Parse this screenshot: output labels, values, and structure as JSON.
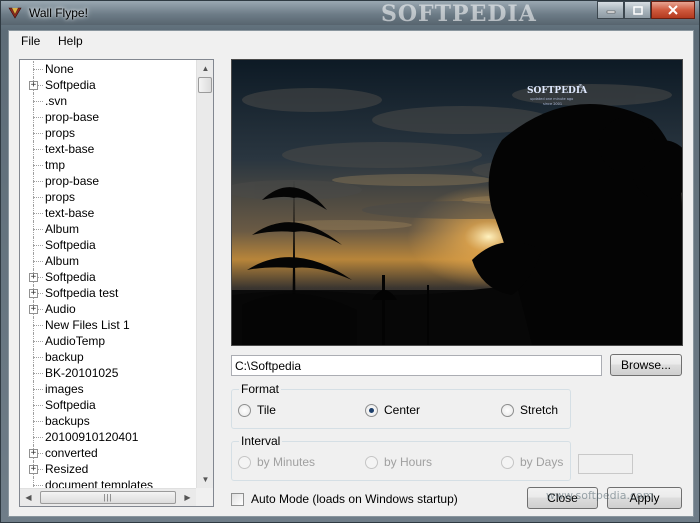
{
  "window": {
    "title": "Wall Flype!",
    "watermark": "SOFTPEDIA"
  },
  "menu": {
    "file": "File",
    "help": "Help"
  },
  "tree": {
    "items": [
      {
        "label": "None",
        "expandable": false
      },
      {
        "label": "Softpedia",
        "expandable": true
      },
      {
        "label": ".svn",
        "expandable": false
      },
      {
        "label": "prop-base",
        "expandable": false
      },
      {
        "label": "props",
        "expandable": false
      },
      {
        "label": "text-base",
        "expandable": false
      },
      {
        "label": "tmp",
        "expandable": false
      },
      {
        "label": "prop-base",
        "expandable": false
      },
      {
        "label": "props",
        "expandable": false
      },
      {
        "label": "text-base",
        "expandable": false
      },
      {
        "label": "Album",
        "expandable": false
      },
      {
        "label": "Softpedia",
        "expandable": false
      },
      {
        "label": "Album",
        "expandable": false
      },
      {
        "label": "Softpedia",
        "expandable": true
      },
      {
        "label": "Softpedia test",
        "expandable": true
      },
      {
        "label": "Audio",
        "expandable": true
      },
      {
        "label": "New Files List 1",
        "expandable": false
      },
      {
        "label": "AudioTemp",
        "expandable": false
      },
      {
        "label": "backup",
        "expandable": false
      },
      {
        "label": "BK-20101025",
        "expandable": false
      },
      {
        "label": "images",
        "expandable": false
      },
      {
        "label": "Softpedia",
        "expandable": false
      },
      {
        "label": "backups",
        "expandable": false
      },
      {
        "label": "20100910120401",
        "expandable": false
      },
      {
        "label": "converted",
        "expandable": true
      },
      {
        "label": "Resized",
        "expandable": true
      },
      {
        "label": "document templates",
        "expandable": false
      }
    ]
  },
  "preview": {
    "logo_text": "SOFTPEDIA",
    "logo_superscript": "®",
    "logo_tagline": "updated one minute ago",
    "logo_since": "since 2001"
  },
  "path": {
    "value": "C:\\Softpedia",
    "browse_label": "Browse..."
  },
  "format": {
    "title": "Format",
    "options": [
      "Tile",
      "Center",
      "Stretch"
    ],
    "selected": "Center"
  },
  "interval": {
    "title": "Interval",
    "options": [
      "by Minutes",
      "by Hours",
      "by Days"
    ],
    "value": ""
  },
  "auto_mode": {
    "label": "Auto Mode (loads on Windows startup)",
    "checked": false
  },
  "buttons": {
    "close": "Close",
    "apply": "Apply"
  },
  "footer_watermark": "www.softpedia.com",
  "colors": {
    "radio_selected": "#1d3f6b",
    "window_frame": "#6f7d88",
    "client_bg": "#f0f0f0"
  }
}
